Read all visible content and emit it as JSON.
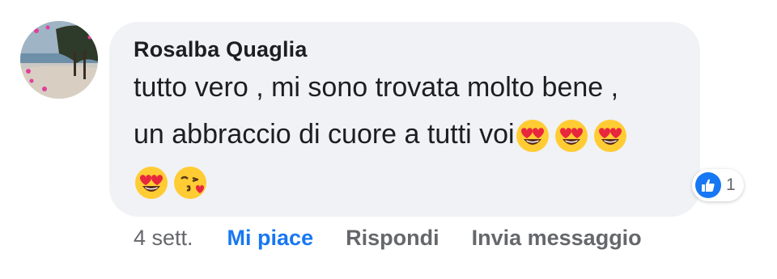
{
  "comment": {
    "author": "Rosalba Quaglia",
    "text_line1": "tutto vero , mi sono trovata molto bene ,",
    "text_line2": "un abbraccio di cuore a tutti voi",
    "emojis_line2": [
      "heart-eyes-emoji",
      "heart-eyes-emoji",
      "heart-eyes-emoji"
    ],
    "emojis_line3": [
      "heart-eyes-emoji",
      "kissing-heart-emoji"
    ],
    "reaction": {
      "type": "like-icon",
      "count": "1",
      "color": "#1877f2"
    }
  },
  "actions": {
    "time": "4 sett.",
    "like_label": "Mi piace",
    "reply_label": "Rispondi",
    "message_label": "Invia messaggio"
  },
  "colors": {
    "bubble": "#f0f2f5",
    "text": "#1c1e21",
    "secondary": "#65676b",
    "accent": "#1877f2"
  }
}
